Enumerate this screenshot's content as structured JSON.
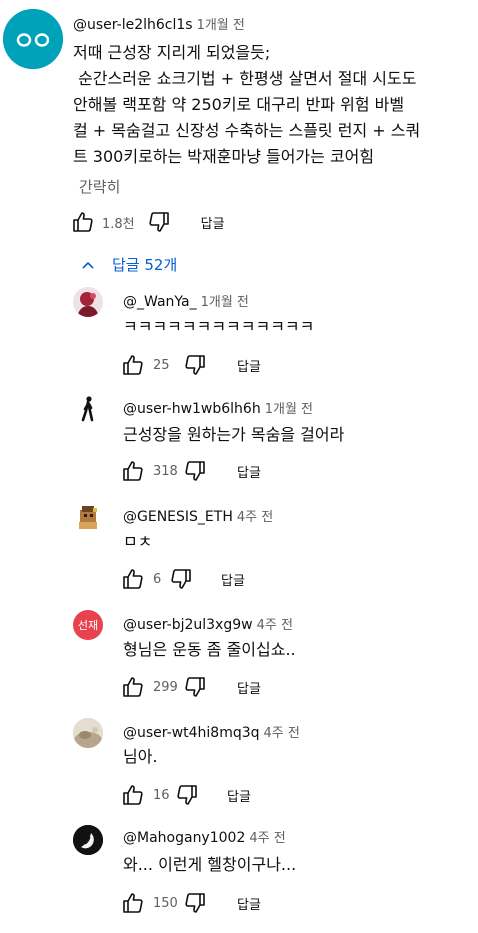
{
  "top_comment": {
    "author": "@user-le2lh6cl1s",
    "time": "1개월 전",
    "lines": [
      "저때 근성장 지리게 되었을듯;",
      " 순간스러운 쇼크기법 + 한평생 살면서 절대 시도도",
      "안해볼 랙포함 약 250키로 대구리 반파 위험 바벨",
      "컬 + 목숨걸고 신장성 수축하는 스플릿 런지 + 스쿼",
      "트 300키로하는 박재훈마냥 들어가는 코어힘"
    ],
    "read_more": "간략히",
    "likes": "1.8천",
    "reply_label": "답글",
    "avatar_color": "#00a2b9"
  },
  "replies_toggle": {
    "label": "답글 52개"
  },
  "replies": [
    {
      "author": "@_WanYa_",
      "time": "1개월 전",
      "text": "ㅋㅋㅋㅋㅋㅋㅋㅋㅋㅋㅋㅋㅋ",
      "likes": "25",
      "reply_label": "답글",
      "avatar": "red-figure-avatar"
    },
    {
      "author": "@user-hw1wb6lh6h",
      "time": "1개월 전",
      "text": "근성장을 원하는가 목숨을 걸어라",
      "likes": "318",
      "reply_label": "답글",
      "avatar": "walking-silhouette-avatar"
    },
    {
      "author": "@GENESIS_ETH",
      "time": "4주 전",
      "text": "ㅁㅊ",
      "likes": "6",
      "reply_label": "답글",
      "avatar": "pixel-character-avatar"
    },
    {
      "author": "@user-bj2ul3xg9w",
      "time": "4주 전",
      "text": "형님은 운동 좀 줄이십쇼..",
      "likes": "299",
      "reply_label": "답글",
      "avatar": "initials-avatar",
      "avatar_text": "선재",
      "avatar_color": "#e8424f"
    },
    {
      "author": "@user-wt4hi8mq3q",
      "time": "4주 전",
      "text": "님아.",
      "likes": "16",
      "reply_label": "답글",
      "avatar": "photo-avatar"
    },
    {
      "author": "@Mahogany1002",
      "time": "4주 전",
      "text": "와... 이런게 헬창이구나...",
      "likes": "150",
      "reply_label": "답글",
      "avatar": "dark-swirl-avatar"
    }
  ]
}
